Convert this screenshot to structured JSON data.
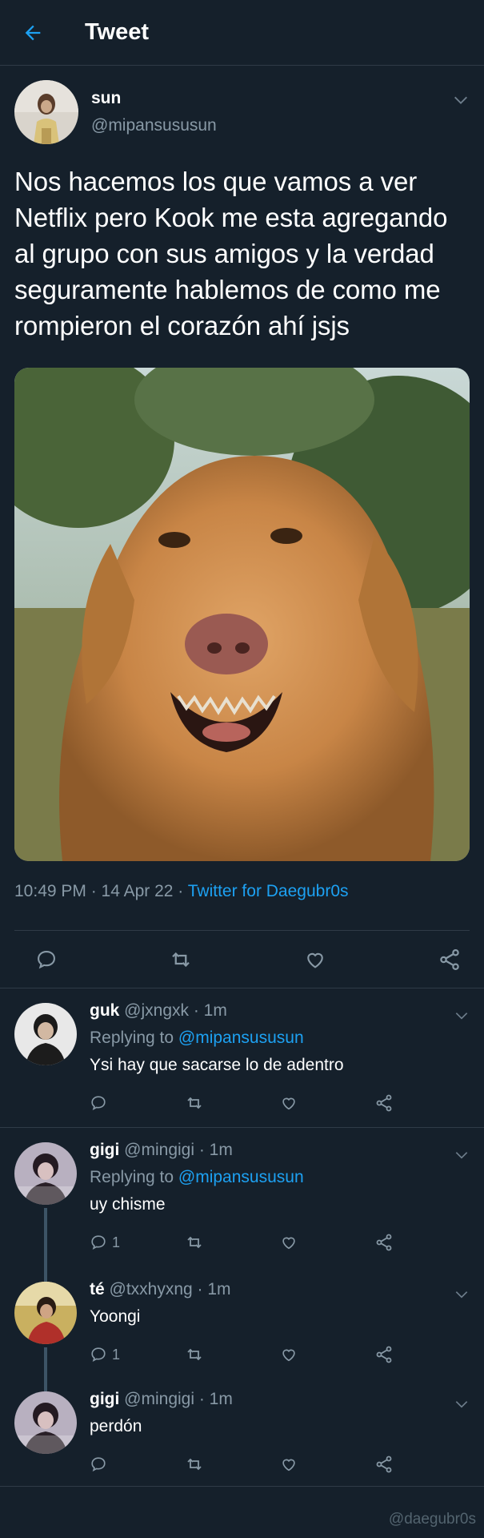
{
  "header": {
    "title": "Tweet"
  },
  "tweet": {
    "name": "sun",
    "handle": "@mipansususun",
    "text": "Nos hacemos los que vamos a ver Netflix pero Kook me esta agregando al grupo con sus amigos y la verdad seguramente hablemos de como me rompieron el corazón ahí jsjs",
    "time": "10:49 PM · 14 Apr 22 · ",
    "source": "Twitter for Daegubr0s"
  },
  "replies": [
    {
      "name": "guk",
      "meta": " @jxngxk · 1m",
      "replying_label": "Replying to ",
      "replying_handle": "@mipansususun",
      "text": "Ysi hay que sacarse lo de adentro",
      "reply_count": ""
    },
    {
      "name": "gigi",
      "meta": " @mingigi · 1m",
      "replying_label": "Replying to ",
      "replying_handle": "@mipansususun",
      "text": "uy chisme",
      "reply_count": "1"
    },
    {
      "name": "té",
      "meta": " @txxhyxng · 1m",
      "text": "Yoongi",
      "reply_count": "1"
    },
    {
      "name": "gigi",
      "meta": " @mingigi · 1m",
      "text": "perdón",
      "reply_count": ""
    }
  ],
  "watermark": "@daegubr0s",
  "colors": {
    "background": "#15202b",
    "accent": "#1da1f2",
    "muted": "#8899a6",
    "divider": "#2f3b47"
  }
}
